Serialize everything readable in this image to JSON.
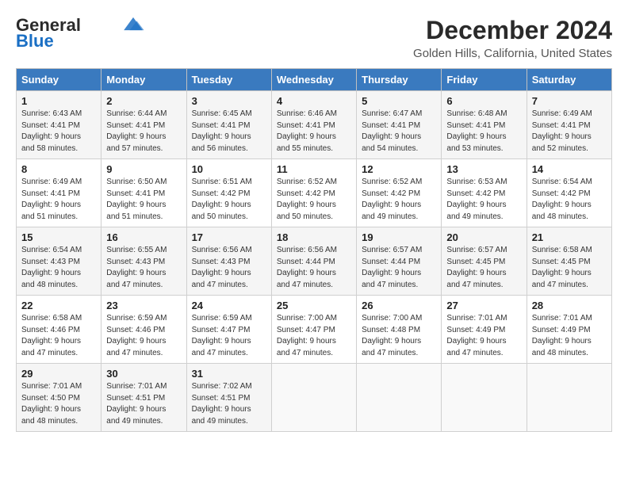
{
  "header": {
    "logo_line1": "General",
    "logo_line2": "Blue",
    "title": "December 2024",
    "subtitle": "Golden Hills, California, United States"
  },
  "weekdays": [
    "Sunday",
    "Monday",
    "Tuesday",
    "Wednesday",
    "Thursday",
    "Friday",
    "Saturday"
  ],
  "weeks": [
    [
      {
        "day": "1",
        "info": "Sunrise: 6:43 AM\nSunset: 4:41 PM\nDaylight: 9 hours\nand 58 minutes."
      },
      {
        "day": "2",
        "info": "Sunrise: 6:44 AM\nSunset: 4:41 PM\nDaylight: 9 hours\nand 57 minutes."
      },
      {
        "day": "3",
        "info": "Sunrise: 6:45 AM\nSunset: 4:41 PM\nDaylight: 9 hours\nand 56 minutes."
      },
      {
        "day": "4",
        "info": "Sunrise: 6:46 AM\nSunset: 4:41 PM\nDaylight: 9 hours\nand 55 minutes."
      },
      {
        "day": "5",
        "info": "Sunrise: 6:47 AM\nSunset: 4:41 PM\nDaylight: 9 hours\nand 54 minutes."
      },
      {
        "day": "6",
        "info": "Sunrise: 6:48 AM\nSunset: 4:41 PM\nDaylight: 9 hours\nand 53 minutes."
      },
      {
        "day": "7",
        "info": "Sunrise: 6:49 AM\nSunset: 4:41 PM\nDaylight: 9 hours\nand 52 minutes."
      }
    ],
    [
      {
        "day": "8",
        "info": "Sunrise: 6:49 AM\nSunset: 4:41 PM\nDaylight: 9 hours\nand 51 minutes."
      },
      {
        "day": "9",
        "info": "Sunrise: 6:50 AM\nSunset: 4:41 PM\nDaylight: 9 hours\nand 51 minutes."
      },
      {
        "day": "10",
        "info": "Sunrise: 6:51 AM\nSunset: 4:42 PM\nDaylight: 9 hours\nand 50 minutes."
      },
      {
        "day": "11",
        "info": "Sunrise: 6:52 AM\nSunset: 4:42 PM\nDaylight: 9 hours\nand 50 minutes."
      },
      {
        "day": "12",
        "info": "Sunrise: 6:52 AM\nSunset: 4:42 PM\nDaylight: 9 hours\nand 49 minutes."
      },
      {
        "day": "13",
        "info": "Sunrise: 6:53 AM\nSunset: 4:42 PM\nDaylight: 9 hours\nand 49 minutes."
      },
      {
        "day": "14",
        "info": "Sunrise: 6:54 AM\nSunset: 4:42 PM\nDaylight: 9 hours\nand 48 minutes."
      }
    ],
    [
      {
        "day": "15",
        "info": "Sunrise: 6:54 AM\nSunset: 4:43 PM\nDaylight: 9 hours\nand 48 minutes."
      },
      {
        "day": "16",
        "info": "Sunrise: 6:55 AM\nSunset: 4:43 PM\nDaylight: 9 hours\nand 47 minutes."
      },
      {
        "day": "17",
        "info": "Sunrise: 6:56 AM\nSunset: 4:43 PM\nDaylight: 9 hours\nand 47 minutes."
      },
      {
        "day": "18",
        "info": "Sunrise: 6:56 AM\nSunset: 4:44 PM\nDaylight: 9 hours\nand 47 minutes."
      },
      {
        "day": "19",
        "info": "Sunrise: 6:57 AM\nSunset: 4:44 PM\nDaylight: 9 hours\nand 47 minutes."
      },
      {
        "day": "20",
        "info": "Sunrise: 6:57 AM\nSunset: 4:45 PM\nDaylight: 9 hours\nand 47 minutes."
      },
      {
        "day": "21",
        "info": "Sunrise: 6:58 AM\nSunset: 4:45 PM\nDaylight: 9 hours\nand 47 minutes."
      }
    ],
    [
      {
        "day": "22",
        "info": "Sunrise: 6:58 AM\nSunset: 4:46 PM\nDaylight: 9 hours\nand 47 minutes."
      },
      {
        "day": "23",
        "info": "Sunrise: 6:59 AM\nSunset: 4:46 PM\nDaylight: 9 hours\nand 47 minutes."
      },
      {
        "day": "24",
        "info": "Sunrise: 6:59 AM\nSunset: 4:47 PM\nDaylight: 9 hours\nand 47 minutes."
      },
      {
        "day": "25",
        "info": "Sunrise: 7:00 AM\nSunset: 4:47 PM\nDaylight: 9 hours\nand 47 minutes."
      },
      {
        "day": "26",
        "info": "Sunrise: 7:00 AM\nSunset: 4:48 PM\nDaylight: 9 hours\nand 47 minutes."
      },
      {
        "day": "27",
        "info": "Sunrise: 7:01 AM\nSunset: 4:49 PM\nDaylight: 9 hours\nand 47 minutes."
      },
      {
        "day": "28",
        "info": "Sunrise: 7:01 AM\nSunset: 4:49 PM\nDaylight: 9 hours\nand 48 minutes."
      }
    ],
    [
      {
        "day": "29",
        "info": "Sunrise: 7:01 AM\nSunset: 4:50 PM\nDaylight: 9 hours\nand 48 minutes."
      },
      {
        "day": "30",
        "info": "Sunrise: 7:01 AM\nSunset: 4:51 PM\nDaylight: 9 hours\nand 49 minutes."
      },
      {
        "day": "31",
        "info": "Sunrise: 7:02 AM\nSunset: 4:51 PM\nDaylight: 9 hours\nand 49 minutes."
      },
      null,
      null,
      null,
      null
    ]
  ]
}
